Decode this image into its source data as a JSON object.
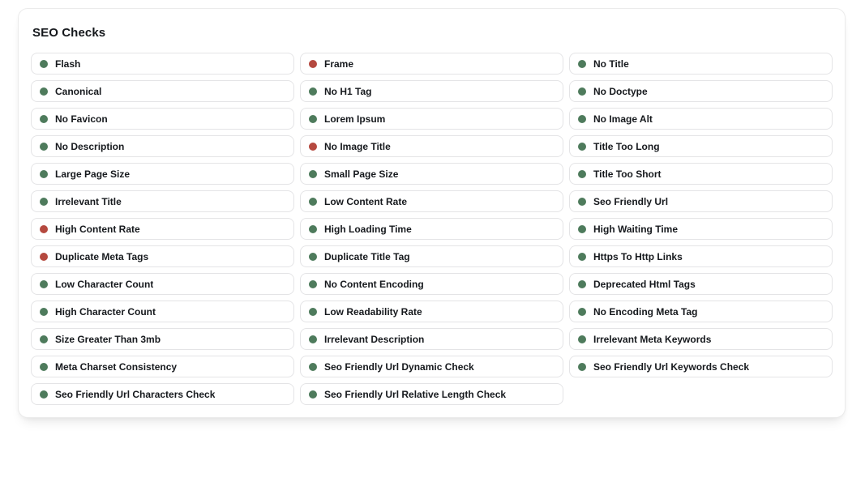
{
  "card": {
    "title": "SEO Checks"
  },
  "status_colors": {
    "passed": "#4e7b5c",
    "failed": "#b5493f"
  },
  "items": [
    {
      "label": "Flash",
      "status": "passed"
    },
    {
      "label": "Frame",
      "status": "failed"
    },
    {
      "label": "No Title",
      "status": "passed"
    },
    {
      "label": "Canonical",
      "status": "passed"
    },
    {
      "label": "No H1 Tag",
      "status": "passed"
    },
    {
      "label": "No Doctype",
      "status": "passed"
    },
    {
      "label": "No Favicon",
      "status": "passed"
    },
    {
      "label": "Lorem Ipsum",
      "status": "passed"
    },
    {
      "label": "No Image Alt",
      "status": "passed"
    },
    {
      "label": "No Description",
      "status": "passed"
    },
    {
      "label": "No Image Title",
      "status": "failed"
    },
    {
      "label": "Title Too Long",
      "status": "passed"
    },
    {
      "label": "Large Page Size",
      "status": "passed"
    },
    {
      "label": "Small Page Size",
      "status": "passed"
    },
    {
      "label": "Title Too Short",
      "status": "passed"
    },
    {
      "label": "Irrelevant Title",
      "status": "passed"
    },
    {
      "label": "Low Content Rate",
      "status": "passed"
    },
    {
      "label": "Seo Friendly Url",
      "status": "passed"
    },
    {
      "label": "High Content Rate",
      "status": "failed"
    },
    {
      "label": "High Loading Time",
      "status": "passed"
    },
    {
      "label": "High Waiting Time",
      "status": "passed"
    },
    {
      "label": "Duplicate Meta Tags",
      "status": "failed"
    },
    {
      "label": "Duplicate Title Tag",
      "status": "passed"
    },
    {
      "label": "Https To Http Links",
      "status": "passed"
    },
    {
      "label": "Low Character Count",
      "status": "passed"
    },
    {
      "label": "No Content Encoding",
      "status": "passed"
    },
    {
      "label": "Deprecated Html Tags",
      "status": "passed"
    },
    {
      "label": "High Character Count",
      "status": "passed"
    },
    {
      "label": "Low Readability Rate",
      "status": "passed"
    },
    {
      "label": "No Encoding Meta Tag",
      "status": "passed"
    },
    {
      "label": "Size Greater Than 3mb",
      "status": "passed"
    },
    {
      "label": "Irrelevant Description",
      "status": "passed"
    },
    {
      "label": "Irrelevant Meta Keywords",
      "status": "passed"
    },
    {
      "label": "Meta Charset Consistency",
      "status": "passed"
    },
    {
      "label": "Seo Friendly Url Dynamic Check",
      "status": "passed"
    },
    {
      "label": "Seo Friendly Url Keywords Check",
      "status": "passed"
    },
    {
      "label": "Seo Friendly Url Characters Check",
      "status": "passed"
    },
    {
      "label": "Seo Friendly Url Relative Length Check",
      "status": "passed"
    }
  ]
}
